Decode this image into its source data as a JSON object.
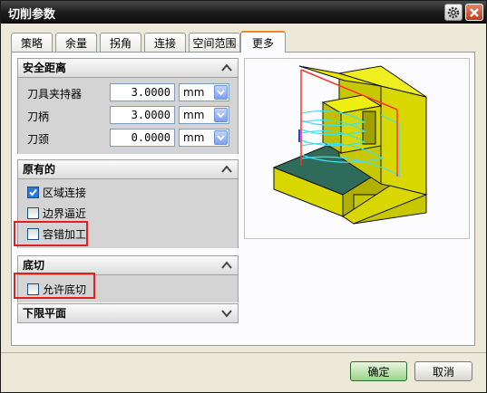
{
  "window": {
    "title": "切削参数",
    "gear_icon": "gear-icon",
    "close_icon": "close-icon"
  },
  "tabs": [
    {
      "label": "策略",
      "active": false
    },
    {
      "label": "余量",
      "active": false
    },
    {
      "label": "拐角",
      "active": false
    },
    {
      "label": "连接",
      "active": false
    },
    {
      "label": "空间范围",
      "active": false
    },
    {
      "label": "更多",
      "active": true
    }
  ],
  "safety_clearance": {
    "header": "安全距离",
    "rows": [
      {
        "label": "刀具夹持器",
        "value": "3.0000",
        "unit": "mm"
      },
      {
        "label": "刀柄",
        "value": "3.0000",
        "unit": "mm"
      },
      {
        "label": "刀颈",
        "value": "0.0000",
        "unit": "mm"
      }
    ]
  },
  "legacy": {
    "header": "原有的",
    "options": [
      {
        "label": "区域连接",
        "checked": true
      },
      {
        "label": "边界逼近",
        "checked": false
      },
      {
        "label": "容错加工",
        "checked": false
      }
    ]
  },
  "undercut": {
    "header": "底切",
    "options": [
      {
        "label": "允许底切",
        "checked": false
      }
    ]
  },
  "lower_limit": {
    "header": "下限平面"
  },
  "footer": {
    "ok_label": "确定",
    "cancel_label": "取消"
  },
  "colors": {
    "accent_tab": "#e68b2c",
    "highlight_box": "#e02020",
    "part_yellow": "#d8d800",
    "floor_teal": "#2e6b5a",
    "toolpath_cyan": "#40e0f0"
  }
}
